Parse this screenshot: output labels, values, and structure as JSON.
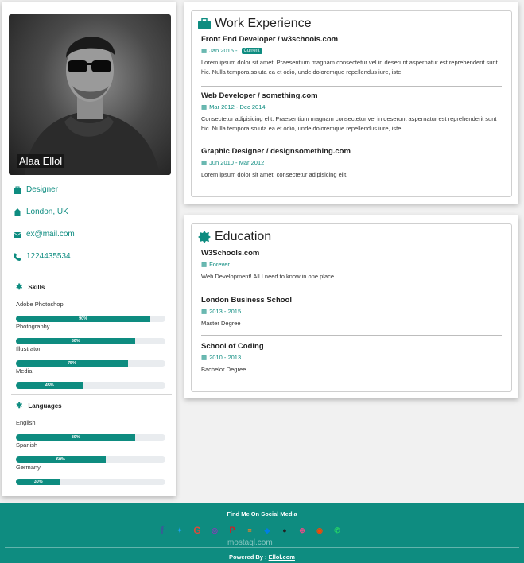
{
  "profile": {
    "name": "Alaa Ellol",
    "job": "Designer",
    "location": "London, UK",
    "email": "ex@mail.com",
    "phone": "1224435534"
  },
  "skills": {
    "title": "Skills",
    "items": [
      {
        "label": "Adobe Photoshop",
        "percent": 90,
        "text": "90%"
      },
      {
        "label": "Photography",
        "percent": 80,
        "text": "80%"
      },
      {
        "label": "Illustrator",
        "percent": 75,
        "text": "75%"
      },
      {
        "label": "Media",
        "percent": 45,
        "text": "45%"
      }
    ]
  },
  "languages": {
    "title": "Languages",
    "items": [
      {
        "label": "English",
        "percent": 80,
        "text": "80%"
      },
      {
        "label": "Spanish",
        "percent": 60,
        "text": "60%"
      },
      {
        "label": "Germany",
        "percent": 30,
        "text": "30%"
      }
    ]
  },
  "work": {
    "title": "Work Experience",
    "entries": [
      {
        "title": "Front End Developer / w3schools.com",
        "date": "Jan 2015 -",
        "badge": "Current",
        "text": "Lorem ipsum dolor sit amet. Praesentium magnam consectetur vel in deserunt aspernatur est reprehenderit sunt hic. Nulla tempora soluta ea et odio, unde doloremque repellendus iure, iste."
      },
      {
        "title": "Web Developer / something.com",
        "date": "Mar 2012 - Dec 2014",
        "text": "Consectetur adipisicing elit. Praesentium magnam consectetur vel in deserunt aspernatur est reprehenderit sunt hic. Nulla tempora soluta ea et odio, unde doloremque repellendus iure, iste."
      },
      {
        "title": "Graphic Designer / designsomething.com",
        "date": "Jun 2010 - Mar 2012",
        "text": "Lorem ipsum dolor sit amet, consectetur adipisicing elit."
      }
    ]
  },
  "education": {
    "title": "Education",
    "entries": [
      {
        "title": "W3Schools.com",
        "date": "Forever",
        "text": "Web Development! All I need to know in one place"
      },
      {
        "title": "London Business School",
        "date": "2013 - 2015",
        "text": "Master Degree"
      },
      {
        "title": "School of Coding",
        "date": "2010 - 2013",
        "text": "Bachelor Degree"
      }
    ]
  },
  "footer": {
    "find": "Find Me On Social Media",
    "powered_prefix": "Powered By :",
    "powered_link": "Ellol.com",
    "watermark": "mostaql.com",
    "socials": [
      "facebook-icon",
      "twitter-icon",
      "google-plus-icon",
      "instagram-icon",
      "pinterest-icon",
      "stack-overflow-icon",
      "dropbox-icon",
      "github-icon",
      "dribbble-icon",
      "reddit-icon",
      "whatsapp-icon"
    ]
  },
  "colors": {
    "accent": "#0e8c80",
    "background": "#f1f1f1"
  }
}
